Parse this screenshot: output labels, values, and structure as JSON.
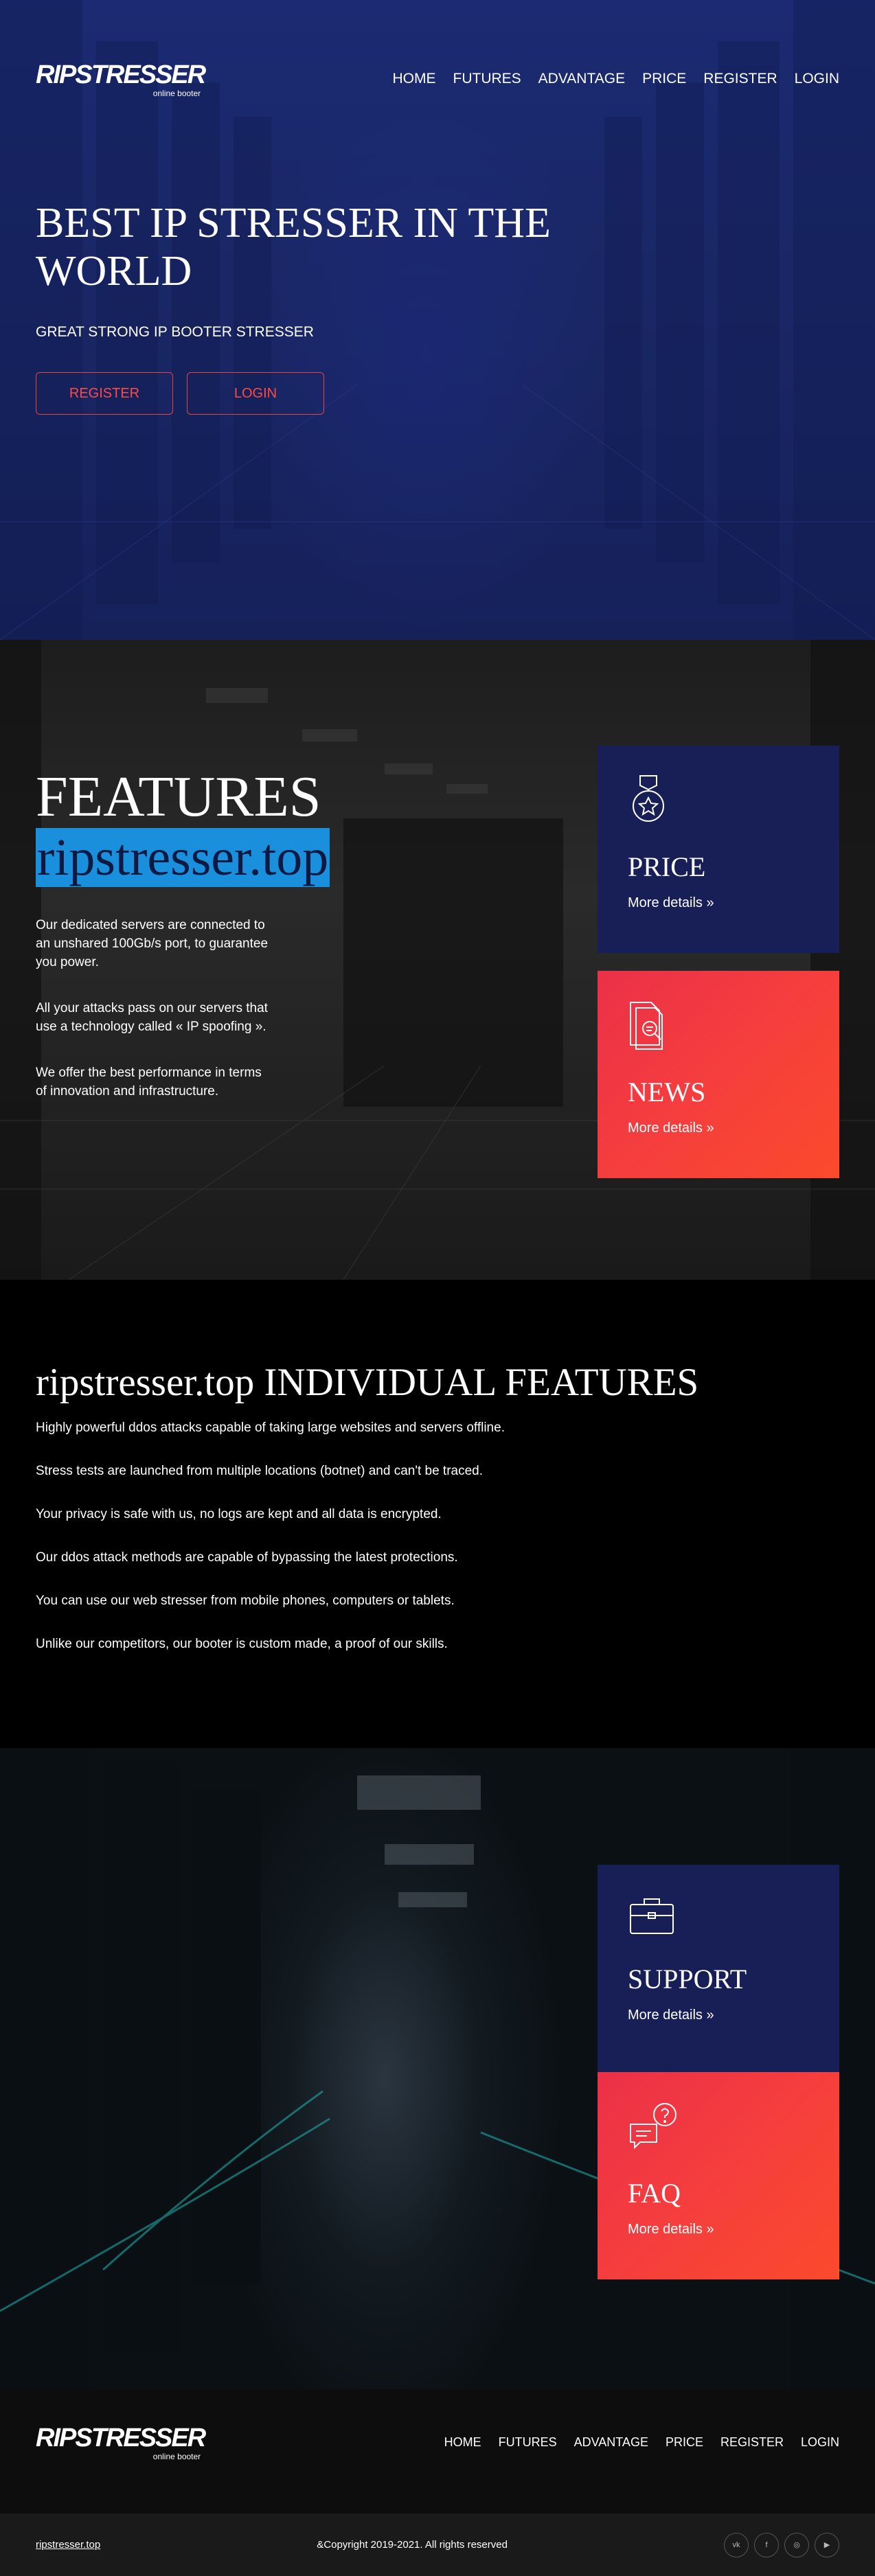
{
  "brand": {
    "logo": "RIPSTRESSER",
    "tagline": "online booter"
  },
  "nav": [
    "HOME",
    "FUTURES",
    "ADVANTAGE",
    "PRICE",
    "REGISTER",
    "LOGIN"
  ],
  "hero": {
    "title": "BEST IP STRESSER IN THE WORLD",
    "subtitle": "GREAT STRONG IP BOOTER STRESSER",
    "register": "REGISTER",
    "login": "LOGIN"
  },
  "features": {
    "heading": "FEATURES",
    "highlight": "ripstresser.top",
    "paragraphs": [
      "Our dedicated servers are connected to an unshared 100Gb/s port, to guarantee you power.",
      "All your attacks pass on our servers that use a technology called « IP spoofing ».",
      "We offer the best performance in terms of innovation and infrastructure."
    ]
  },
  "cards": {
    "price": {
      "title": "PRICE",
      "more": "More details »",
      "icon": "award-badge-icon"
    },
    "news": {
      "title": "NEWS",
      "more": "More details »",
      "icon": "document-search-icon"
    },
    "support": {
      "title": "SUPPORT",
      "more": "More details »",
      "icon": "briefcase-icon"
    },
    "faq": {
      "title": "FAQ",
      "more": "More details »",
      "icon": "chat-question-icon"
    }
  },
  "individual": {
    "heading": "ripstresser.top INDIVIDUAL FEATURES",
    "items": [
      "Highly powerful ddos attacks capable of taking large websites and servers offline.",
      "Stress tests are launched from multiple locations (botnet) and can't be traced.",
      "Your privacy is safe with us, no logs are kept and all data is encrypted.",
      "Our ddos attack methods are capable of bypassing the latest protections.",
      "You can use our web stresser from mobile phones, computers or tablets.",
      "Unlike our competitors, our booter is custom made, a proof of our skills."
    ]
  },
  "footer": {
    "site": "ripstresser.top",
    "copyright": "&Copyright 2019-2021. All rights reserved",
    "socials": [
      "vk-icon",
      "facebook-icon",
      "instagram-icon",
      "youtube-icon"
    ]
  },
  "colors": {
    "navy": "#181f57",
    "red": "#f53e3d",
    "accent_blue": "#1a90dd"
  }
}
